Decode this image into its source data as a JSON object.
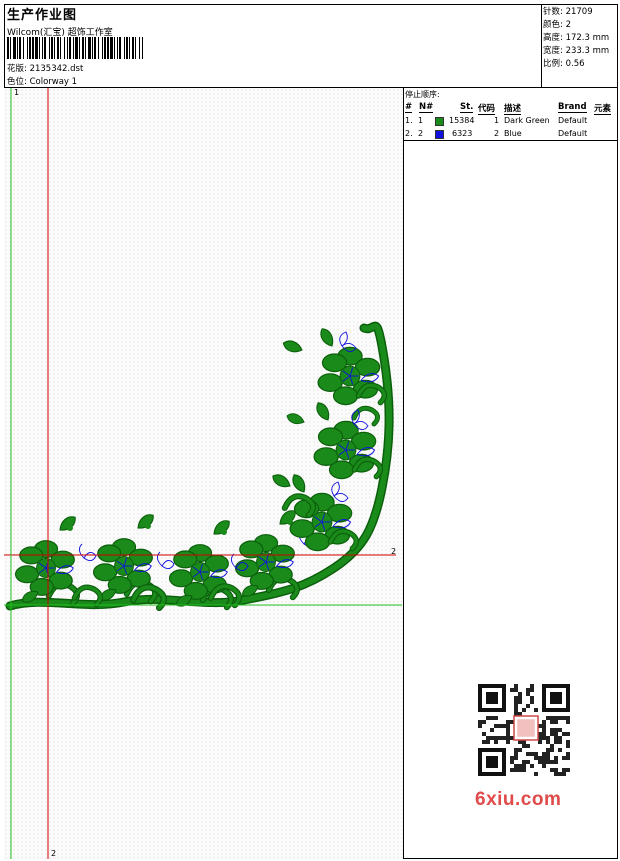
{
  "header": {
    "title": "生产作业图",
    "subtitle": "Wilcom(汇宝) 超饰工作室",
    "design_label": "花版:",
    "design_value": "2135342.dst",
    "colorway_label": "色位:",
    "colorway_value": "Colorway 1"
  },
  "stats": [
    {
      "label": "针数:",
      "value": "21709"
    },
    {
      "label": "颜色:",
      "value": "2"
    },
    {
      "label": "高度:",
      "value": "172.3 mm"
    },
    {
      "label": "宽度:",
      "value": "233.3 mm"
    },
    {
      "label": "比例:",
      "value": "0.56"
    }
  ],
  "stop_sequence": {
    "heading": "停止顺序:",
    "columns": [
      "#",
      "N#",
      "St.",
      "代码",
      "描述",
      "Brand",
      "元素"
    ],
    "rows": [
      {
        "num": "1.",
        "n": "1",
        "stitches": "15384",
        "code": "1",
        "description": "Dark Green",
        "brand": "Default",
        "color": "#1a8a1a"
      },
      {
        "num": "2.",
        "n": "2",
        "stitches": "6323",
        "code": "2",
        "description": "Blue",
        "brand": "Default",
        "color": "#1010e0"
      }
    ]
  },
  "canvas": {
    "marker_top": "1",
    "marker_right": "2",
    "marker_bottom": "2",
    "fill_color": "#1a8a1a",
    "outline_color": "#0b5f0b",
    "accent_color": "#1010e0",
    "guide_red": "#d00000",
    "guide_green": "#20c020"
  },
  "watermark": {
    "brand": "6xiu.com"
  }
}
